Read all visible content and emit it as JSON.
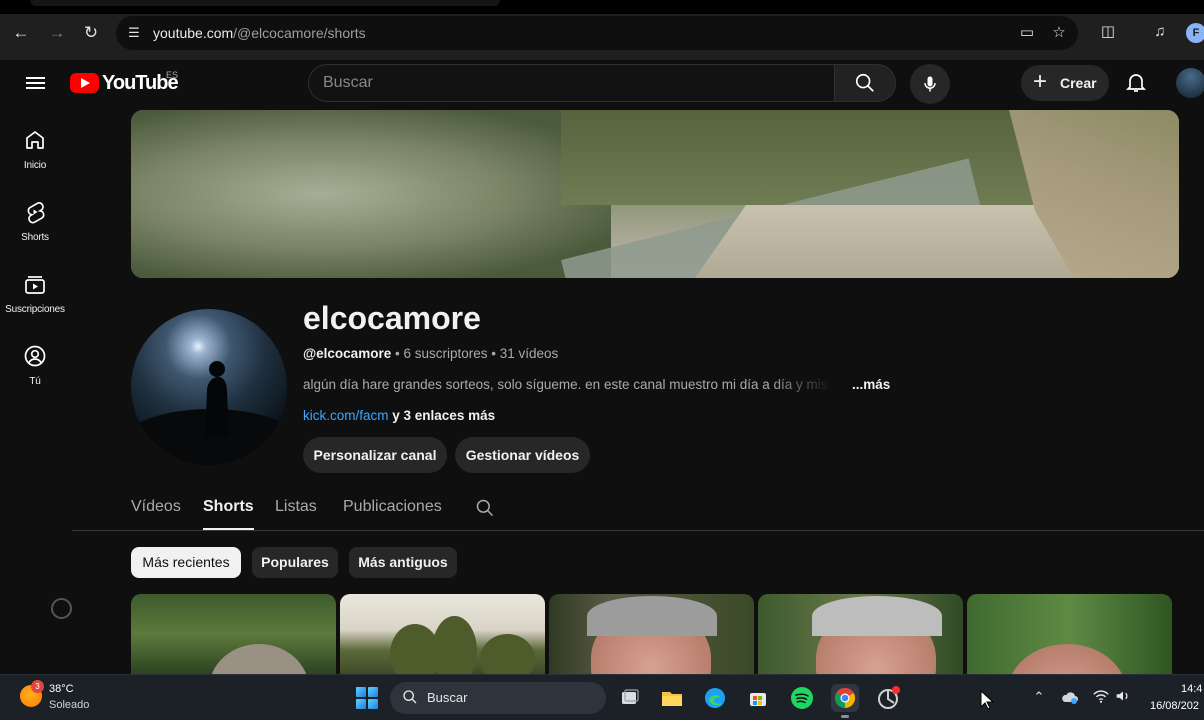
{
  "browser": {
    "url_host": "youtube.com",
    "url_path": "/@elcocamore/shorts",
    "profile_initial": "F"
  },
  "header": {
    "logo_text": "YouTube",
    "country_code": "ES",
    "search_placeholder": "Buscar",
    "create_label": "Crear"
  },
  "sidebar": {
    "items": [
      {
        "label": "Inicio",
        "icon": "home-icon"
      },
      {
        "label": "Shorts",
        "icon": "shorts-icon"
      },
      {
        "label": "Suscripciones",
        "icon": "subscriptions-icon"
      },
      {
        "label": "Tú",
        "icon": "you-icon"
      }
    ]
  },
  "channel": {
    "name": "elcocamore",
    "handle": "@elcocamore",
    "meta": " • 6 suscriptores • 31 vídeos",
    "description": "algún día hare grandes sorteos, solo sígueme. en este canal muestro mi día a día y mis",
    "more_label": "...más",
    "link": "kick.com/facm",
    "more_links": " y 3 enlaces más",
    "buttons": {
      "customize": "Personalizar canal",
      "manage": "Gestionar vídeos"
    }
  },
  "tabs": [
    {
      "label": "Vídeos",
      "active": false
    },
    {
      "label": "Shorts",
      "active": true
    },
    {
      "label": "Listas",
      "active": false
    },
    {
      "label": "Publicaciones",
      "active": false
    }
  ],
  "chips": [
    {
      "label": "Más recientes",
      "active": true
    },
    {
      "label": "Populares",
      "active": false
    },
    {
      "label": "Más antiguos",
      "active": false
    }
  ],
  "taskbar": {
    "weather_temp": "38°C",
    "weather_condition": "Soleado",
    "weather_badge": "3",
    "search_label": "Buscar",
    "time": "14:4",
    "date": "16/08/202"
  },
  "colors": {
    "background": "#0f0f0f",
    "brand_red": "#ff0000",
    "link_blue": "#3ea6ff",
    "chip_bg": "#272727"
  }
}
